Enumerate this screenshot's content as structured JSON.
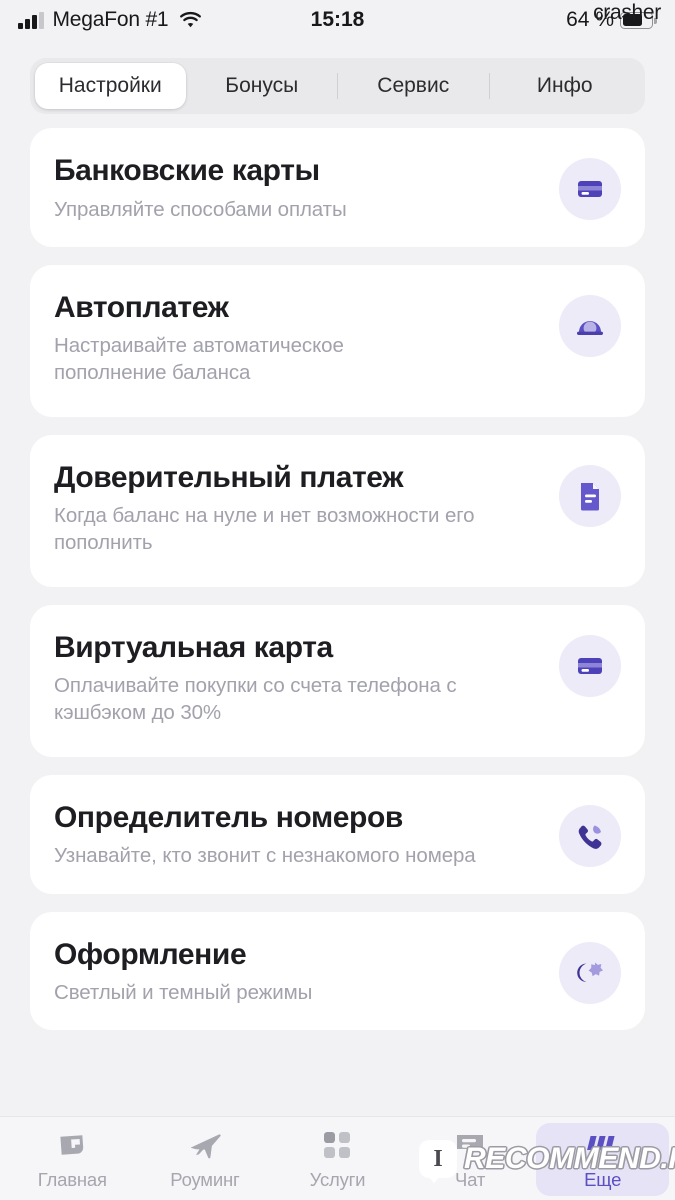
{
  "status_bar": {
    "carrier": "MegaFon #1",
    "signal_icon": "signal-bars-icon",
    "wifi_icon": "wifi-icon",
    "time": "15:18",
    "battery_percent": "64 %",
    "battery_icon": "battery-icon",
    "battery_level": 64
  },
  "watermarks": {
    "top_right": "crasher",
    "bottom": "RECOMMEND.RU",
    "bottom_badge": "I"
  },
  "tabs": [
    {
      "label": "Настройки",
      "active": true
    },
    {
      "label": "Бонусы",
      "active": false
    },
    {
      "label": "Сервис",
      "active": false
    },
    {
      "label": "Инфо",
      "active": false
    }
  ],
  "cards": [
    {
      "title": "Банковские карты",
      "subtitle": "Управляйте способами оплаты",
      "icon": "credit-card-icon",
      "tall": false
    },
    {
      "title": "Автоплатеж",
      "subtitle": "Настраивайте автоматическое пополнение баланса",
      "icon": "piggy-bank-icon",
      "tall": true
    },
    {
      "title": "Доверительный платеж",
      "subtitle": "Когда баланс на нуле и нет возможности его пополнить",
      "icon": "document-icon",
      "tall": true
    },
    {
      "title": "Виртуальная карта",
      "subtitle": "Оплачивайте покупки со счета телефона с кэшбэком до 30%",
      "icon": "credit-card-icon",
      "tall": true
    },
    {
      "title": "Определитель номеров",
      "subtitle": "Узнавайте, кто звонит с незнакомого номера",
      "icon": "phone-handset-icon",
      "tall": false
    },
    {
      "title": "Оформление",
      "subtitle": "Светлый и темный режимы",
      "icon": "moon-sun-icon",
      "tall": false
    }
  ],
  "bottom_nav": [
    {
      "label": "Главная",
      "icon": "megafon-logo-icon",
      "active": false
    },
    {
      "label": "Роуминг",
      "icon": "airplane-icon",
      "active": false
    },
    {
      "label": "Услуги",
      "icon": "grid-squares-icon",
      "active": false
    },
    {
      "label": "Чат",
      "icon": "chat-bubble-icon",
      "active": false
    },
    {
      "label": "Еще",
      "icon": "more-bars-icon",
      "active": true
    }
  ],
  "colors": {
    "page_background": "#f2f2f4",
    "card_background": "#ffffff",
    "title_text": "#1e1e22",
    "subtitle_text": "#a2a2ac",
    "accent_purple": "#5b4fc4",
    "accent_purple_light": "#9b91e0",
    "icon_bubble": "#ecebf7",
    "tabbar_background": "#e9e9ec",
    "nav_inactive": "#a6a6ae",
    "nav_active_background": "#e5e3f5"
  }
}
